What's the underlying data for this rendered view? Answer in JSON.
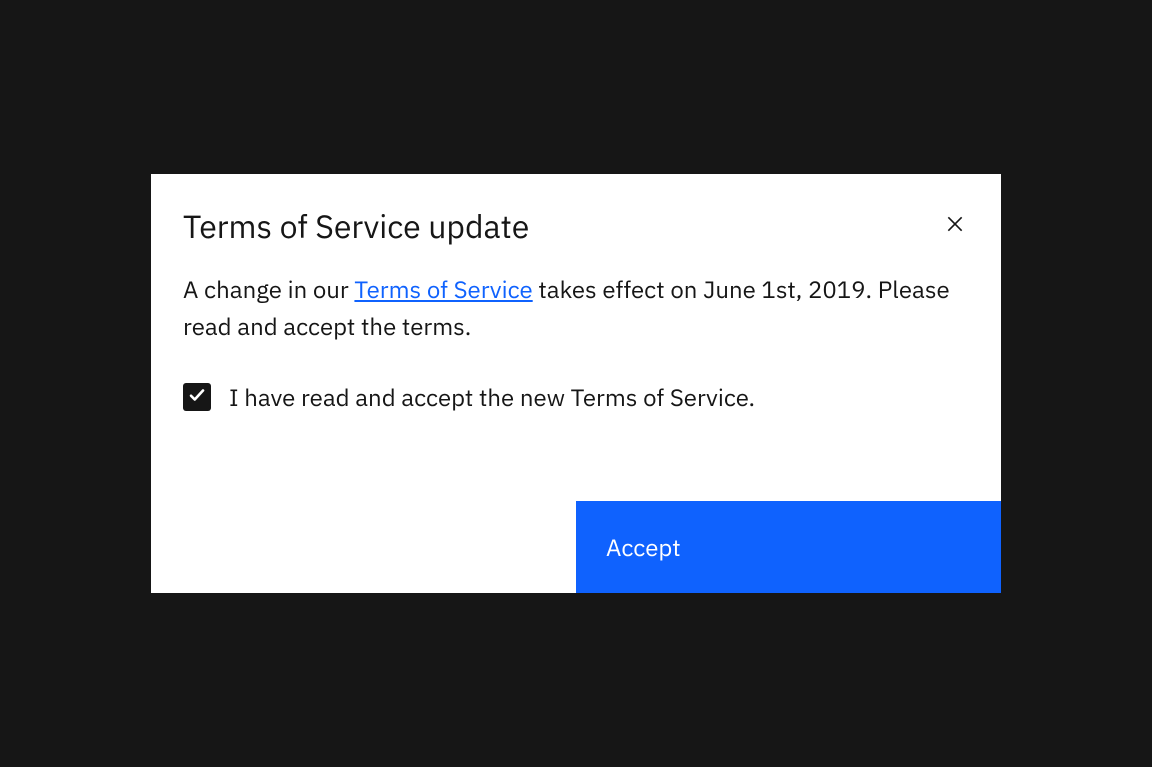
{
  "modal": {
    "title": "Terms of Service update",
    "body_text_before": "A change in our ",
    "terms_link_text": "Terms of Service",
    "body_text_after": " takes effect on June 1st, 2019. Please read and accept the terms.",
    "checkbox_label": "I have read and accept the new Terms of Service.",
    "accept_button_label": "Accept"
  }
}
